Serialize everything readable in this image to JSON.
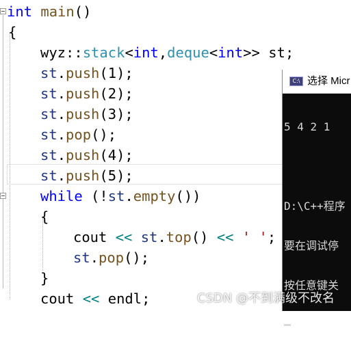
{
  "editor": {
    "lines": {
      "l1": {
        "kw": "int",
        "name": " main",
        "rest": "()"
      },
      "l2": {
        "text": "{"
      },
      "l3": {
        "ns": "wyz",
        "sep": "::",
        "stack": "stack",
        "lt1": "<",
        "int1": "int",
        "comma": ",",
        "deque": "deque",
        "lt2": "<",
        "int2": "int",
        "gt": ">>",
        "var": " st;"
      },
      "l4": {
        "obj": "st",
        "dot": ".",
        "fn": "push",
        "open": "(",
        "arg": "1",
        "close": ");"
      },
      "l5": {
        "obj": "st",
        "dot": ".",
        "fn": "push",
        "open": "(",
        "arg": "2",
        "close": ");"
      },
      "l6": {
        "obj": "st",
        "dot": ".",
        "fn": "push",
        "open": "(",
        "arg": "3",
        "close": ");"
      },
      "l7": {
        "obj": "st",
        "dot": ".",
        "fn": "pop",
        "rest": "();"
      },
      "l8": {
        "obj": "st",
        "dot": ".",
        "fn": "push",
        "open": "(",
        "arg": "4",
        "close": ");"
      },
      "l9": {
        "obj": "st",
        "dot": ".",
        "fn": "push",
        "open": "(",
        "arg": "5",
        "close": ");"
      },
      "l10": {
        "kw": "while",
        "open": " (!",
        "obj": "st",
        "dot": ".",
        "fn": "empty",
        "rest": "())"
      },
      "l11": {
        "text": "{"
      },
      "l12": {
        "cout": "cout",
        "op1": " << ",
        "obj": "st",
        "dot": ".",
        "fn": "top",
        "paren": "()",
        "op2": " << ",
        "str": "' '",
        "semi": ";"
      },
      "l13": {
        "obj": "st",
        "dot": ".",
        "fn": "pop",
        "rest": "();"
      },
      "l14": {
        "text": "}"
      },
      "l15": {
        "cout": "cout",
        "op": " << ",
        "endl": "endl",
        "semi": ";"
      }
    }
  },
  "console": {
    "icon_name": "console-app-icon",
    "icon_text": "C:\\",
    "title": "选择 Micr",
    "output": [
      "5 4 2 1",
      "",
      "D:\\C++程序",
      "要在调试停",
      "按任意键关"
    ]
  },
  "watermark": "CSDN @不到满级不改名",
  "colors": {
    "keyword": "#0000ff",
    "function": "#74531f",
    "type": "#2b91af",
    "string": "#a31515",
    "operator": "#008080",
    "console_bg": "#0c0c0c"
  }
}
